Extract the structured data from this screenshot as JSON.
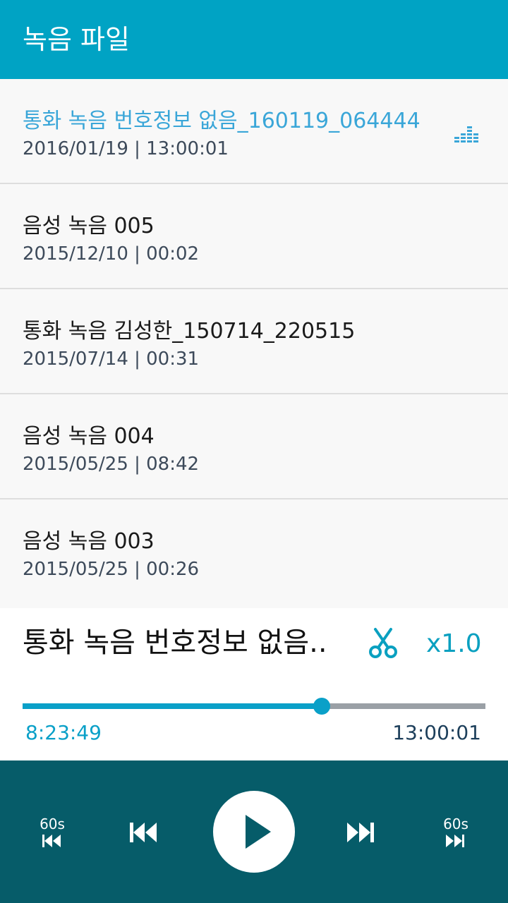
{
  "appbar": {
    "title": "녹음 파일"
  },
  "recordings": [
    {
      "name": "통화 녹음 번호정보 없음_160119_064444",
      "meta": "2016/01/19 | 13:00:01",
      "active": true
    },
    {
      "name": "음성 녹음 005",
      "meta": "2015/12/10 | 00:02"
    },
    {
      "name": "통화 녹음 김성한_150714_220515",
      "meta": "2015/07/14 | 00:31"
    },
    {
      "name": "음성 녹음 004",
      "meta": "2015/05/25 | 08:42"
    },
    {
      "name": "음성 녹음 003",
      "meta": "2015/05/25 | 00:26"
    }
  ],
  "player": {
    "title": "통화 녹음 번호정보 없음..",
    "speed": "x1.0",
    "current_time": "8:23:49",
    "total_time": "13:00:01",
    "progress": 0.647
  },
  "controls": {
    "rewind_label": "60s",
    "forward_label": "60s"
  },
  "icons": {
    "equalizer": "equalizer-icon",
    "trim": "scissors-icon",
    "rewind": "rewind-60s-icon",
    "previous": "skip-previous-icon",
    "play": "play-icon",
    "next": "skip-next-icon",
    "forward": "forward-60s-icon"
  },
  "colors": {
    "appbar": "#00a3c4",
    "active_text": "#3aa6d8",
    "accent": "#0aa0c8",
    "controls_bg": "#065c69"
  }
}
